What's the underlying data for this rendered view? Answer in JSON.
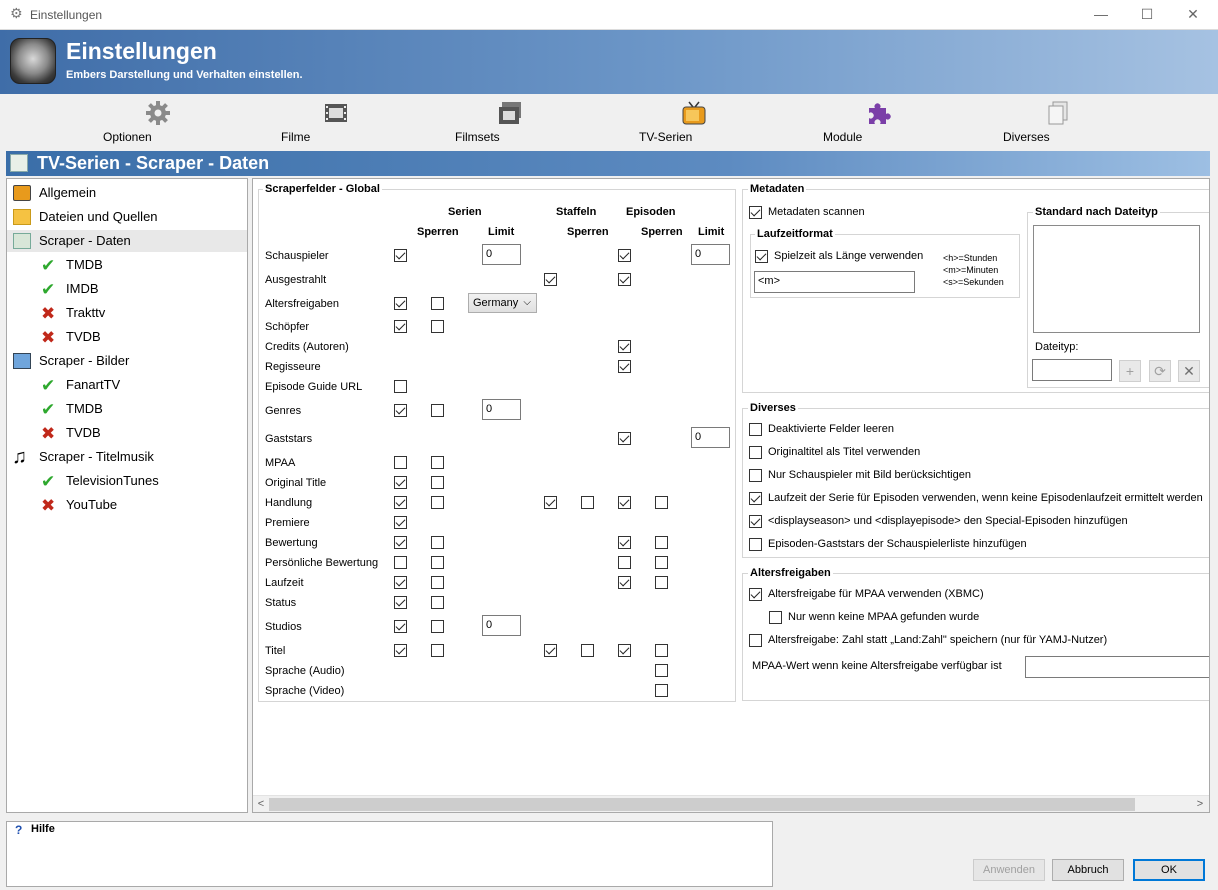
{
  "window": {
    "title": "Einstellungen",
    "minimize": "—",
    "maximize": "☐",
    "close": "✕"
  },
  "banner": {
    "title": "Einstellungen",
    "subtitle": "Embers Darstellung und Verhalten einstellen."
  },
  "toolbar": {
    "items": [
      {
        "label": "Optionen",
        "icon": "gear-icon"
      },
      {
        "label": "Filme",
        "icon": "film-icon"
      },
      {
        "label": "Filmsets",
        "icon": "filmset-icon"
      },
      {
        "label": "TV-Serien",
        "icon": "tv-icon"
      },
      {
        "label": "Module",
        "icon": "puzzle-icon"
      },
      {
        "label": "Diverses",
        "icon": "documents-icon"
      }
    ]
  },
  "section_title": "TV-Serien - Scraper - Daten",
  "tree": {
    "items": [
      {
        "label": "Allgemein",
        "icon": "tv-icon"
      },
      {
        "label": "Dateien und Quellen",
        "icon": "folder-icon"
      },
      {
        "label": "Scraper - Daten",
        "icon": "data-icon",
        "selected": true
      },
      {
        "label": "TMDB",
        "icon": "check-icon"
      },
      {
        "label": "IMDB",
        "icon": "check-icon"
      },
      {
        "label": "Trakttv",
        "icon": "cross-icon"
      },
      {
        "label": "TVDB",
        "icon": "cross-icon"
      },
      {
        "label": "Scraper - Bilder",
        "icon": "image-icon"
      },
      {
        "label": "FanartTV",
        "icon": "check-icon"
      },
      {
        "label": "TMDB",
        "icon": "check-icon"
      },
      {
        "label": "TVDB",
        "icon": "cross-icon"
      },
      {
        "label": "Scraper - Titelmusik",
        "icon": "music-icon"
      },
      {
        "label": "TelevisionTunes",
        "icon": "check-icon"
      },
      {
        "label": "YouTube",
        "icon": "cross-icon"
      }
    ]
  },
  "global": {
    "title": "Scraperfelder - Global",
    "headers": {
      "serien": "Serien",
      "staffeln": "Staffeln",
      "episoden": "Episoden",
      "sperren1": "Sperren",
      "limit1": "Limit",
      "sperren2": "Sperren",
      "sperren3": "Sperren",
      "limit2": "Limit"
    },
    "rows": {
      "schauspieler": "Schauspieler",
      "ausgestrahlt": "Ausgestrahlt",
      "altersfreigaben": "Altersfreigaben",
      "schoepfer": "Schöpfer",
      "credits": "Credits (Autoren)",
      "regisseure": "Regisseure",
      "episodeguide": "Episode Guide URL",
      "genres": "Genres",
      "gaststars": "Gaststars",
      "mpaa": "MPAA",
      "originaltitle": "Original Title",
      "handlung": "Handlung",
      "premiere": "Premiere",
      "bewertung": "Bewertung",
      "persbewertung": "Persönliche Bewertung",
      "laufzeit": "Laufzeit",
      "status": "Status",
      "studios": "Studios",
      "titel": "Titel",
      "sprache_audio": "Sprache (Audio)",
      "sprache_video": "Sprache (Video)"
    },
    "limits": {
      "schauspieler_serie": "0",
      "schauspieler_episode": "0",
      "genres": "0",
      "gaststars": "0",
      "studios": "0"
    },
    "country": "Germany"
  },
  "metadaten": {
    "title": "Metadaten",
    "scan_label": "Metadaten scannen",
    "laufzeit_title": "Laufzeitformat",
    "spielzeit_label": "Spielzeit als Länge verwenden",
    "format_value": "<m>",
    "hint_h": "<h>=Stunden",
    "hint_m": "<m>=Minuten",
    "hint_s": "<s>=Sekunden",
    "standard_title": "Standard nach Dateityp",
    "dateityp_label": "Dateityp:",
    "add": "+",
    "refresh": "⟳",
    "remove": "✕"
  },
  "diverses": {
    "title": "Diverses",
    "items": [
      "Deaktivierte Felder leeren",
      "Originaltitel als Titel verwenden",
      "Nur Schauspieler mit Bild berücksichtigen",
      "Laufzeit der Serie für Episoden verwenden, wenn keine Episodenlaufzeit ermittelt werden",
      "<displayseason> und <displayepisode> den Special-Episoden hinzufügen",
      "Episoden-Gaststars der Schauspielerliste hinzufügen"
    ]
  },
  "altersfreigaben": {
    "title": "Altersfreigaben",
    "mpaa_xbmc": "Altersfreigabe für MPAA verwenden (XBMC)",
    "only_no_mpaa": "Nur wenn keine MPAA gefunden wurde",
    "land_zahl": "Altersfreigabe: Zahl statt „Land:Zahl\" speichern (nur für YAMJ-Nutzer)",
    "mpaa_default": "MPAA-Wert wenn keine Altersfreigabe verfügbar ist"
  },
  "help": {
    "icon": "?",
    "title": "Hilfe"
  },
  "buttons": {
    "apply": "Anwenden",
    "cancel": "Abbruch",
    "ok": "OK"
  },
  "scroll": {
    "left": "<",
    "right": ">"
  }
}
